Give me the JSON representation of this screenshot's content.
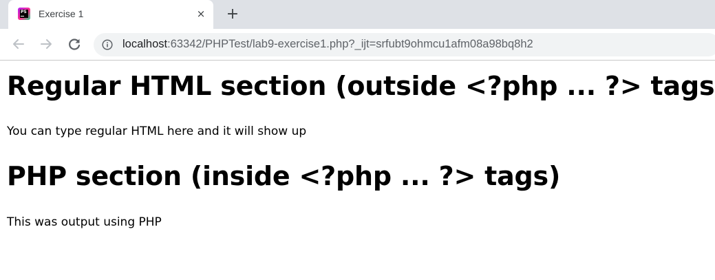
{
  "browser": {
    "tab": {
      "title": "Exercise 1",
      "favicon_text": "PS",
      "favicon": "phpstorm-icon",
      "close": "×"
    },
    "new_tab": "+",
    "nav": {
      "back": "back-arrow-icon",
      "forward": "forward-arrow-icon",
      "reload": "reload-icon"
    },
    "address_bar": {
      "host": "localhost",
      "rest": ":63342/PHPTest/lab9-exercise1.php?_ijt=srfubt9ohmcu1afm08a98bq8h2",
      "info_icon": "info-icon"
    }
  },
  "page": {
    "heading1": "Regular HTML section (outside <?php ... ?> tags)",
    "paragraph1": "You can type regular HTML here and it will show up",
    "heading2": "PHP section (inside <?php ... ?> tags)",
    "paragraph2": "This was output using PHP"
  },
  "colors": {
    "tabstrip_bg": "#dee1e6",
    "omnibox_bg": "#f1f3f4",
    "text": "#000000"
  }
}
